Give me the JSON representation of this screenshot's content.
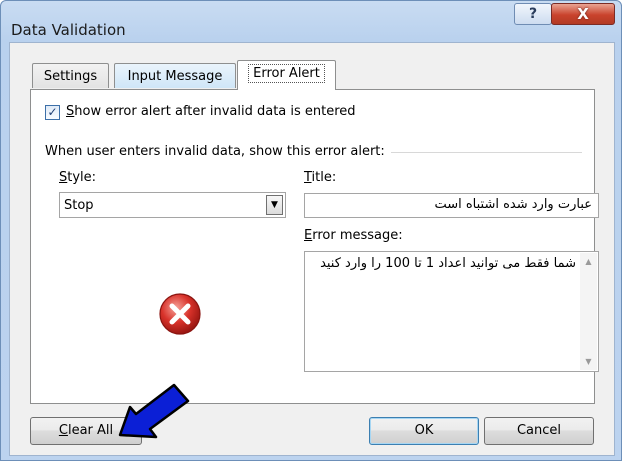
{
  "window": {
    "title": "Data Validation",
    "help_label": "?",
    "close_label": "X"
  },
  "tabs": [
    {
      "label": "Settings",
      "active": false
    },
    {
      "label": "Input Message",
      "active": false
    },
    {
      "label": "Error Alert",
      "active": true
    }
  ],
  "error_alert": {
    "show_alert_checked": true,
    "show_alert_label_accel": "S",
    "show_alert_label_rest": "how error alert after invalid data is entered",
    "group_label": "When user enters invalid data, show this error alert:",
    "style_label_accel": "S",
    "style_label_rest": "tyle:",
    "style_value": "Stop",
    "title_label_accel": "T",
    "title_label_rest": "itle:",
    "title_value": "عبارت وارد شده اشتباه است",
    "message_label_accel": "E",
    "message_label_rest": "rror message:",
    "message_value": "شما فقط می توانید اعداد 1 تا 100 را وارد کنید",
    "icon": "stop-icon"
  },
  "buttons": {
    "clear_accel": "C",
    "clear_rest": "lear All",
    "ok": "OK",
    "cancel": "Cancel"
  },
  "annotation": {
    "icon": "blue-pointer-arrow-icon",
    "color": "#0b1fd6"
  }
}
